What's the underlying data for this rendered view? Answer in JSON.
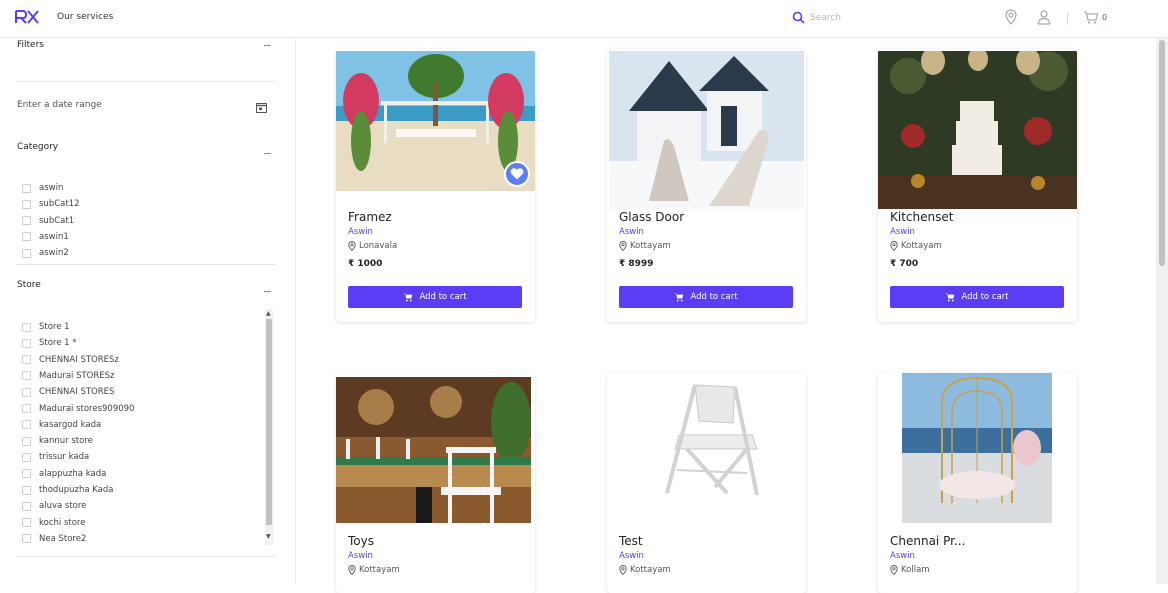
{
  "header": {
    "nav_link": "Our services",
    "search_placeholder": "Search",
    "cart_count": "0",
    "accent": "#5b3df5"
  },
  "sidebar": {
    "filters_title": "Filters",
    "date_placeholder": "Enter a date range",
    "category_title": "Category",
    "categories": [
      "aswin",
      "subCat12",
      "subCat1",
      "aswin1",
      "aswin2"
    ],
    "store_title": "Store",
    "stores": [
      "Store 1",
      "Store 1 *",
      "CHENNAI STORESz",
      "Madurai STORESz",
      "CHENNAI STORES",
      "Madurai stores909090",
      "kasargod kada",
      "kannur store",
      "trissur kada",
      "alappuzha kada",
      "thodupuzha Kada",
      "aluva store",
      "kochi store",
      "Nea Store2"
    ]
  },
  "products": [
    {
      "title": "Framez",
      "category": "Aswin",
      "location": "Lonavala",
      "price": "₹ 1000",
      "button": "Add to cart",
      "favorite": true
    },
    {
      "title": "Glass Door",
      "category": "Aswin",
      "location": "Kottayam",
      "price": "₹ 8999",
      "button": "Add to cart"
    },
    {
      "title": "Kitchenset",
      "category": "Aswin",
      "location": "Kottayam",
      "price": "₹ 700",
      "button": "Add to cart"
    },
    {
      "title": "Toys",
      "category": "Aswin",
      "location": "Kottayam"
    },
    {
      "title": "Test",
      "category": "Aswin",
      "location": "Kottayam"
    },
    {
      "title": "Chennai Pr...",
      "category": "Aswin",
      "location": "Kollam"
    }
  ]
}
